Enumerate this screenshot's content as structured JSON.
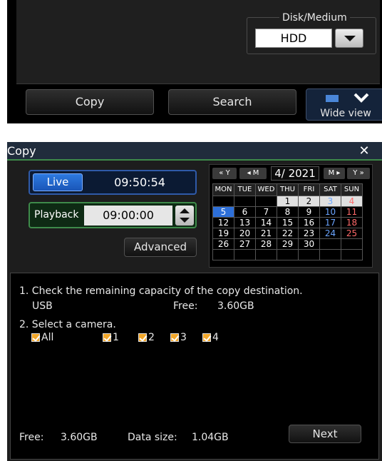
{
  "top_panel": {
    "disk_label": "Disk/Medium",
    "disk_value": "HDD",
    "copy_tab": "Copy",
    "search_tab": "Search",
    "wide_view": "Wide view"
  },
  "window": {
    "title": "Copy",
    "close_icon": "close-icon",
    "live": {
      "button": "Live",
      "time": "09:50:54"
    },
    "playback": {
      "label": "Playback",
      "time": "09:00:00"
    },
    "advanced": "Advanced"
  },
  "calendar": {
    "nav_prev_year": "« Y",
    "nav_prev_month": "◂ M",
    "month": "4/ 2021",
    "nav_next_month": "M ▸",
    "nav_next_year": "Y »",
    "weekdays": [
      "MON",
      "TUE",
      "WED",
      "THU",
      "FRI",
      "SAT",
      "SUN"
    ],
    "weeks": [
      [
        "",
        "",
        "",
        "1",
        "2",
        "3",
        "4"
      ],
      [
        "5",
        "6",
        "7",
        "8",
        "9",
        "10",
        "11"
      ],
      [
        "12",
        "13",
        "14",
        "15",
        "16",
        "17",
        "18"
      ],
      [
        "19",
        "20",
        "21",
        "22",
        "23",
        "24",
        "25"
      ],
      [
        "26",
        "27",
        "28",
        "29",
        "30",
        "",
        ""
      ],
      [
        "",
        "",
        "",
        "",
        "",
        "",
        ""
      ]
    ],
    "selected_day": "5",
    "colors": {
      "selected": "#2d6fd8",
      "saturday": "#6ba5ff",
      "sunday": "#ff6a6a"
    }
  },
  "content": {
    "step1": "1. Check the remaining capacity of the copy destination.",
    "dest_name": "USB",
    "dest_free_label": "Free:",
    "dest_free_value": "3.60GB",
    "step2": "2. Select a camera.",
    "cameras": [
      {
        "label": "All",
        "checked": true
      },
      {
        "label": "1",
        "checked": true
      },
      {
        "label": "2",
        "checked": true
      },
      {
        "label": "3",
        "checked": true
      },
      {
        "label": "4",
        "checked": true
      }
    ],
    "footer_free_label": "Free:",
    "footer_free_value": "3.60GB",
    "data_size_label": "Data size:",
    "data_size_value": "1.04GB",
    "next": "Next"
  }
}
